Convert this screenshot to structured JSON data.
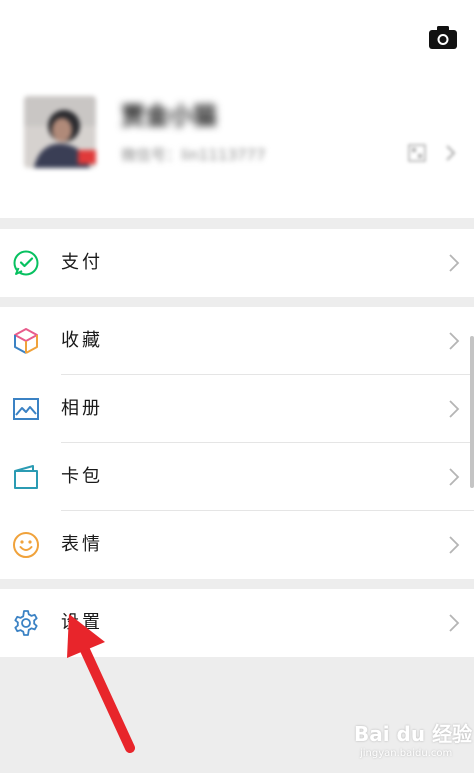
{
  "profile": {
    "name": "贾金小猫",
    "wechat_id": "微信号：lin1113777"
  },
  "menu": {
    "pay": {
      "label": "支付",
      "icon": "wechat-pay-icon",
      "color": "#07c160"
    },
    "favorites": {
      "label": "收藏",
      "icon": "favorites-cube-icon"
    },
    "album": {
      "label": "相册",
      "icon": "album-icon",
      "color": "#3b82c4"
    },
    "cards": {
      "label": "卡包",
      "icon": "card-wallet-icon",
      "color": "#2b9bb3"
    },
    "stickers": {
      "label": "表情",
      "icon": "sticker-smile-icon",
      "color": "#f0a23b"
    },
    "settings": {
      "label": "设置",
      "icon": "settings-gear-icon",
      "color": "#3b82c4"
    }
  },
  "watermark": {
    "text": "Bai du 经验",
    "sub": "jingyan.baidu.com"
  },
  "annotation_color": "#e8252b"
}
